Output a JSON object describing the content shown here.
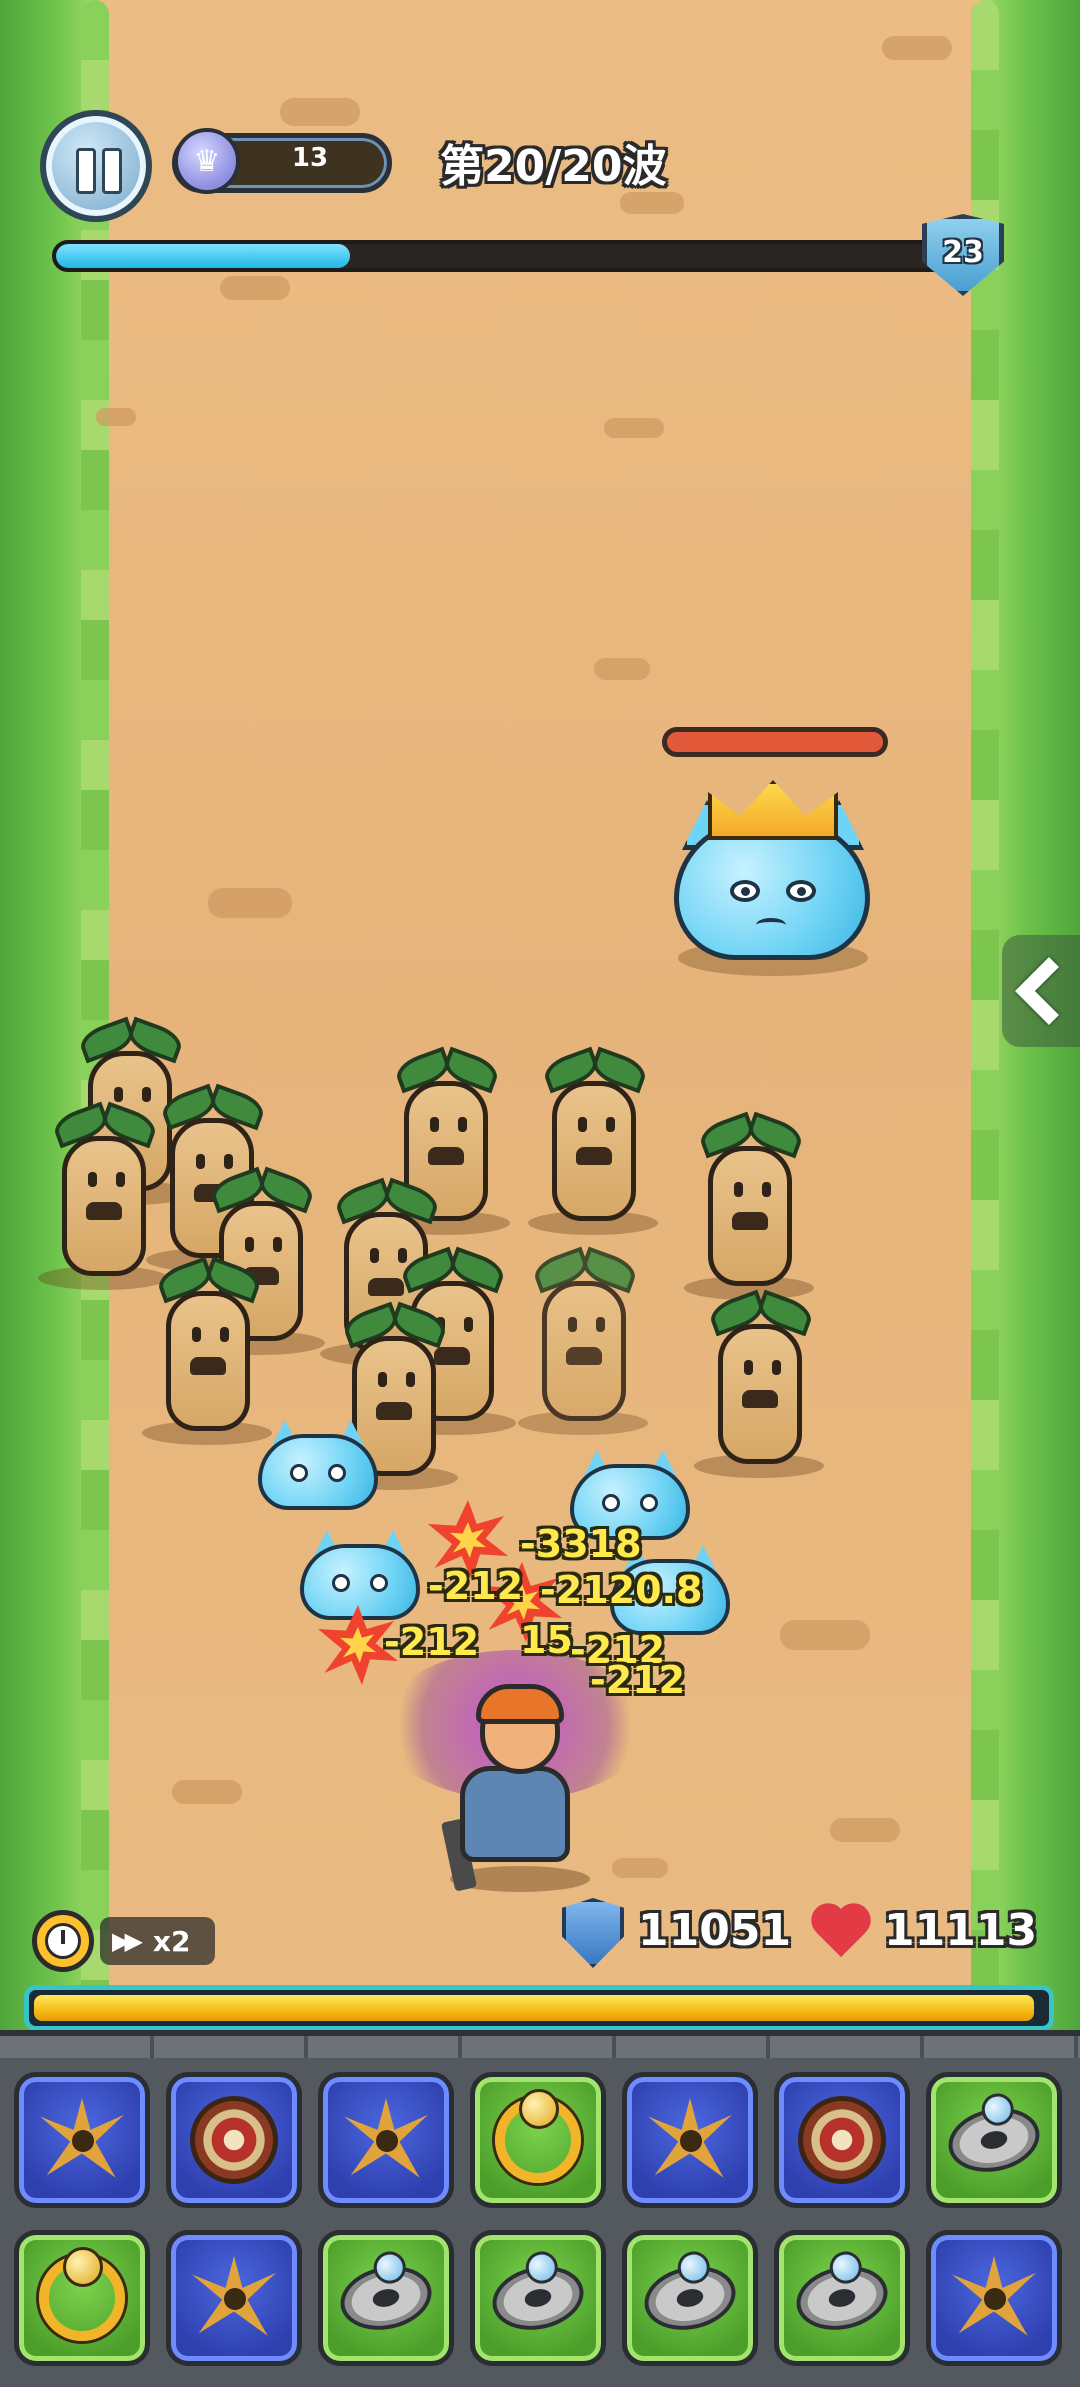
{
  "hud": {
    "pause_label": "",
    "crown_count": "13",
    "wave_text": "第20/20波",
    "wave_progress": 0.33,
    "level": "23"
  },
  "boss": {
    "name": "",
    "hp_fraction": 1.0
  },
  "damage_numbers": [
    "-3318",
    "-212",
    "-2120.8",
    "-212",
    "15",
    "-212",
    "-212"
  ],
  "controls": {
    "speed_label": "x2"
  },
  "stats": {
    "shield_value": "11051",
    "health_value": "11113"
  },
  "energy": {
    "fill_fraction": 0.99
  },
  "inventory": {
    "row1": [
      {
        "item": "shuriken-icon",
        "rarity": "blue"
      },
      {
        "item": "round-shield-icon",
        "rarity": "blue"
      },
      {
        "item": "shuriken-icon",
        "rarity": "blue"
      },
      {
        "item": "necklace-icon",
        "rarity": "green"
      },
      {
        "item": "shuriken-icon",
        "rarity": "blue"
      },
      {
        "item": "round-shield-icon",
        "rarity": "blue"
      },
      {
        "item": "ring-icon",
        "rarity": "green"
      }
    ],
    "row2": [
      {
        "item": "necklace-icon",
        "rarity": "green"
      },
      {
        "item": "shuriken-icon",
        "rarity": "blue"
      },
      {
        "item": "ring-icon",
        "rarity": "green"
      },
      {
        "item": "ring-icon",
        "rarity": "green"
      },
      {
        "item": "ring-icon",
        "rarity": "green"
      },
      {
        "item": "ring-icon",
        "rarity": "green"
      },
      {
        "item": "shuriken-icon",
        "rarity": "blue"
      }
    ]
  },
  "colors": {
    "wave_bar": "#22b7e6",
    "boss_hp": "#e25a3a",
    "energy_bar": "#f4b40f",
    "slot_blue": "#2e3fae",
    "slot_green": "#4c9e2a"
  }
}
